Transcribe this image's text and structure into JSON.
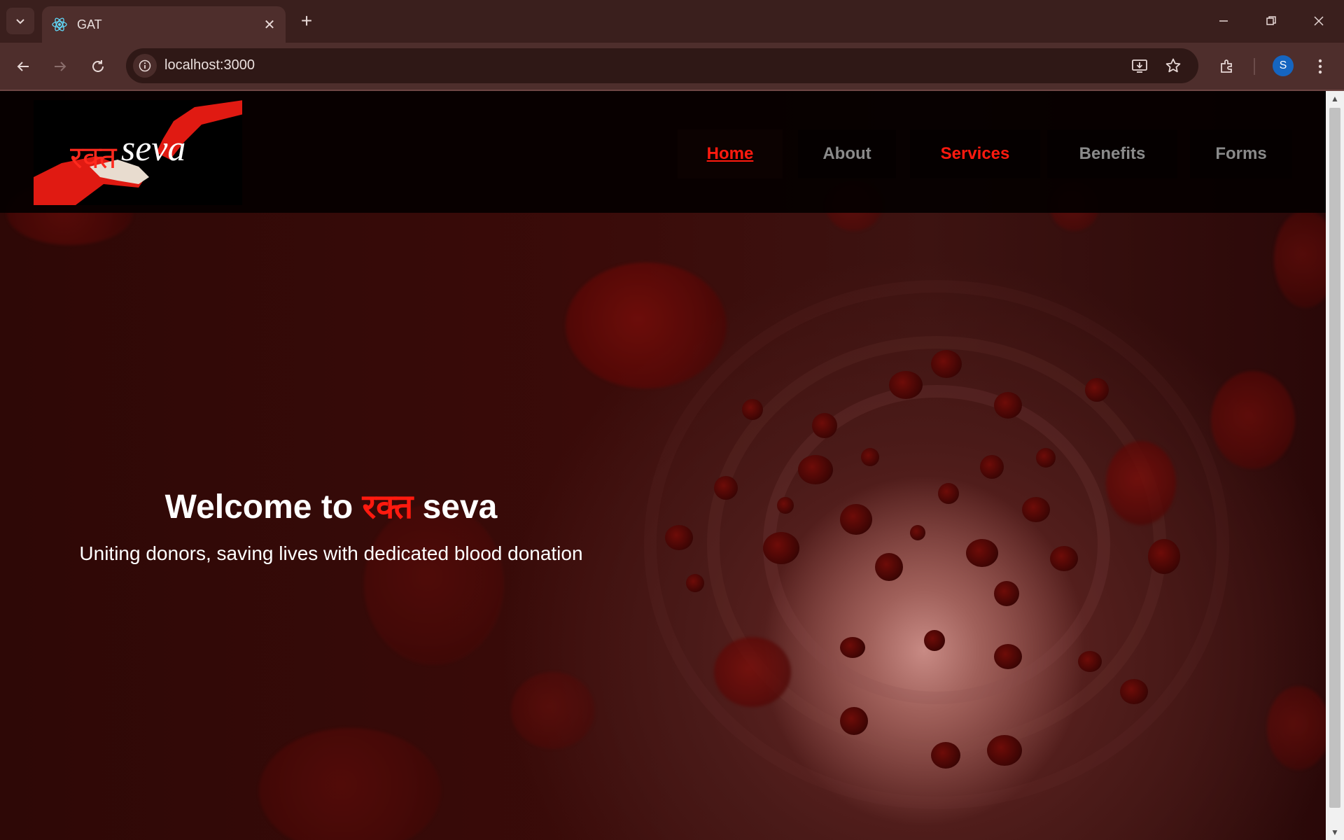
{
  "browser": {
    "tab_title": "GAT",
    "url": "localhost:3000",
    "profile_initial": "S"
  },
  "site": {
    "logo": {
      "hindi": "रक्त",
      "latin": "seva"
    },
    "nav": [
      {
        "label": "Home",
        "state": "active"
      },
      {
        "label": "About",
        "state": "normal"
      },
      {
        "label": "Services",
        "state": "highlight"
      },
      {
        "label": "Benefits",
        "state": "normal"
      },
      {
        "label": "Forms",
        "state": "normal"
      }
    ],
    "hero": {
      "title_prefix": "Welcome to",
      "title_accent": "रक्त",
      "title_suffix": "seva",
      "subtitle": "Uniting donors, saving lives with dedicated blood donation"
    }
  },
  "colors": {
    "accent": "#ff1a0f",
    "header_bg": "#050000",
    "chrome_bg": "#3a1f1d"
  },
  "icons": [
    "tab-search-icon",
    "react-favicon-icon",
    "close-icon",
    "new-tab-icon",
    "minimize-icon",
    "restore-icon",
    "window-close-icon",
    "back-arrow-icon",
    "forward-arrow-icon",
    "reload-icon",
    "site-info-icon",
    "install-app-icon",
    "bookmark-star-icon",
    "extensions-icon",
    "more-menu-icon"
  ]
}
